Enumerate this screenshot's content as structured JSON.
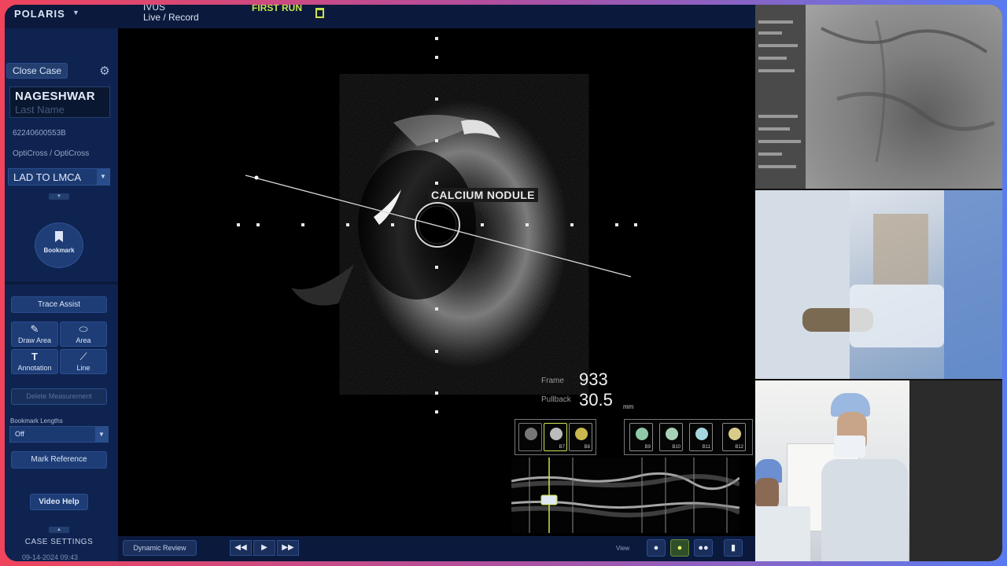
{
  "app": {
    "logo": "POLARIS",
    "mode_line1": "IVUS",
    "mode_line2": "Live / Record",
    "run_label": "FIRST RUN"
  },
  "sidebar": {
    "close_case": "Close Case",
    "patient_first": "NAGESHWAR",
    "patient_last_placeholder": "Last Name",
    "patient_id": "62240600553B",
    "catheter": "OptiCross / OptiCross",
    "vessel": "LAD TO LMCA",
    "bookmark": "Bookmark",
    "trace_assist": "Trace Assist",
    "tools": [
      {
        "label": "Draw Area",
        "icon": "pencil-icon"
      },
      {
        "label": "Area",
        "icon": "area-icon"
      },
      {
        "label": "Annotation",
        "icon": "text-icon"
      },
      {
        "label": "Line",
        "icon": "line-icon"
      }
    ],
    "delete_measurement": "Delete Measurement",
    "bookmark_lengths_label": "Bookmark Lengths",
    "bookmark_lengths_value": "Off",
    "mark_reference": "Mark Reference",
    "video_help": "Video Help",
    "case_settings": "CASE SETTINGS",
    "case_date": "09-14-2024 09:43"
  },
  "viewer": {
    "annotation": "CALCIUM NODULE",
    "frame_label": "Frame",
    "frame_value": "933",
    "pullback_label": "Pullback",
    "pullback_value": "30.5",
    "pullback_unit": "mm",
    "thumbnails": [
      "B7",
      "B8",
      "B9",
      "B10",
      "B11",
      "B12"
    ]
  },
  "bottom": {
    "dynamic_review": "Dynamic Review",
    "rewind": "◀◀",
    "play": "▶",
    "forward": "▶▶",
    "view_label": "View",
    "view_buttons": [
      "●",
      "●",
      "●●"
    ]
  },
  "colors": {
    "sidebar_bg": "#0f2350",
    "accent_yellow": "#c9e34f",
    "button_bg": "#1e3d76"
  }
}
